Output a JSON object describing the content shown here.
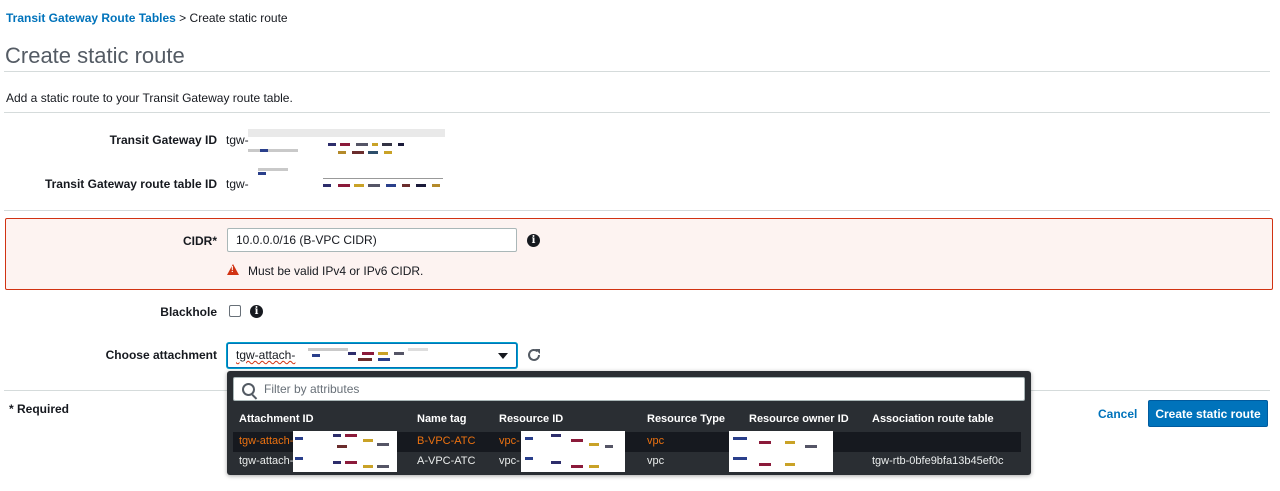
{
  "breadcrumb": {
    "link": "Transit Gateway Route Tables",
    "separator": ">",
    "current": "Create static route"
  },
  "page_title": "Create static route",
  "description": "Add a static route to your Transit Gateway route table.",
  "fields": {
    "tgw_id_label": "Transit Gateway ID",
    "tgw_id_prefix": "tgw-",
    "rtb_id_label": "Transit Gateway route table ID",
    "rtb_id_prefix": "tgw-",
    "cidr_label": "CIDR*",
    "cidr_value": "10.0.0.0/16 (B-VPC CIDR)",
    "cidr_error": "Must be valid IPv4 or IPv6 CIDR.",
    "blackhole_label": "Blackhole",
    "attachment_label": "Choose attachment",
    "attachment_value": "tgw-attach-"
  },
  "dropdown": {
    "filter_placeholder": "Filter by attributes",
    "columns": [
      "Attachment ID",
      "Name tag",
      "Resource ID",
      "Resource Type",
      "Resource owner ID",
      "Association route table"
    ],
    "rows": [
      {
        "attachment_id": "tgw-attach-",
        "name_tag": "B-VPC-ATC",
        "resource_id": "vpc-",
        "resource_type": "vpc",
        "owner_id": "",
        "route_table": ""
      },
      {
        "attachment_id": "tgw-attach-",
        "name_tag": "A-VPC-ATC",
        "resource_id": "vpc-",
        "resource_type": "vpc",
        "owner_id": "",
        "route_table": "tgw-rtb-0bfe9bfa13b45ef0c"
      }
    ]
  },
  "footer": {
    "required": "* Required",
    "cancel": "Cancel",
    "create": "Create static route"
  },
  "icons": {
    "info": "info-icon",
    "warning": "warning-icon",
    "refresh": "refresh-icon",
    "search": "search-icon",
    "caret": "caret-down-icon"
  },
  "colors": {
    "link": "#0073bb",
    "error": "#d13212",
    "primary": "#0073bb",
    "highlight": "#ec7211"
  }
}
